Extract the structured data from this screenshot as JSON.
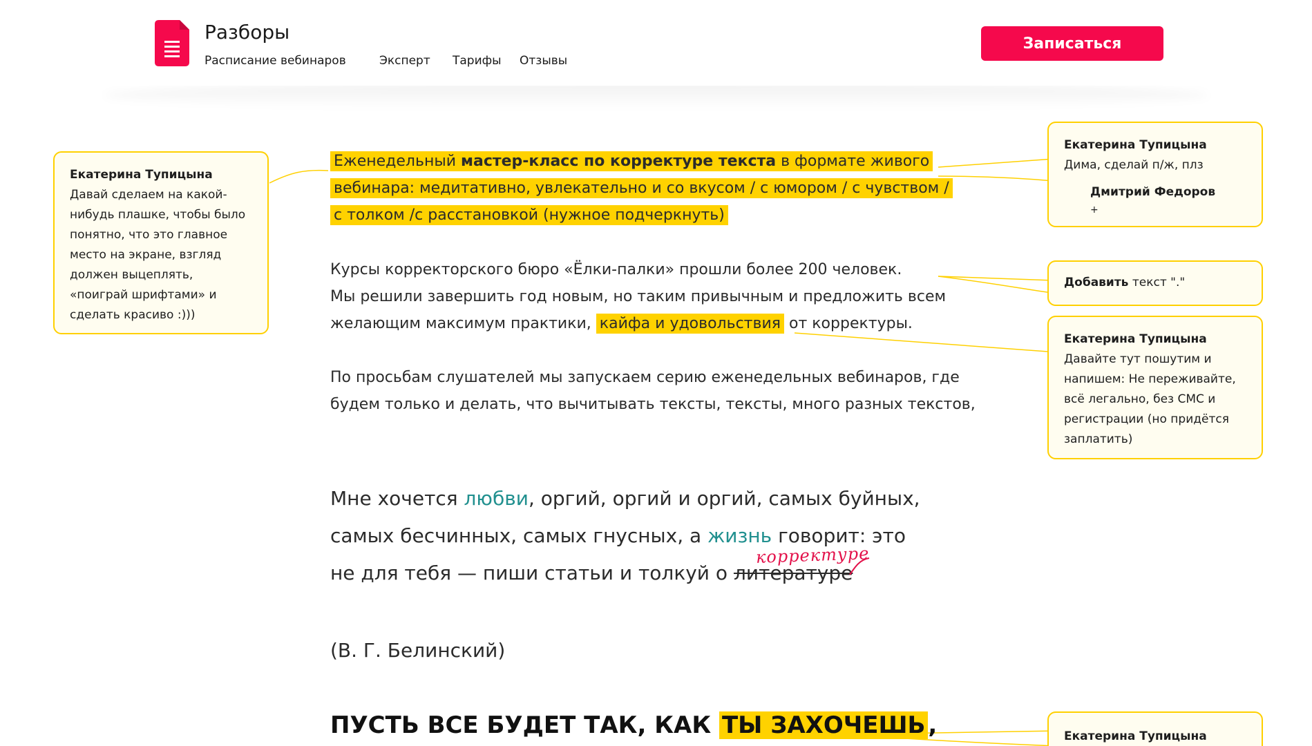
{
  "header": {
    "brand": "Разборы",
    "nav": [
      "Расписание вебинаров",
      "Эксперт",
      "Тарифы",
      "Отзывы"
    ],
    "cta_label": "Записаться"
  },
  "content": {
    "intro": {
      "p1": "Еженедельный ",
      "p1_bold": "мастер-класс по корректуре текста",
      "p1_end": " в формате живого",
      "line2": "вебинара: медитативно, увлекательно и со вкусом / с юмором / с чувством /",
      "line3": "с толком /с расстановкой (нужное подчеркнуть)"
    },
    "about": {
      "line1": "Курсы корректорского бюро «Ёлки-палки» прошли более 200 человек.",
      "line2": "Мы решили завершить год новым, но таким привычным и предложить всем",
      "line3_a": "желающим максимум практики, ",
      "line3_hl": "кайфа и удовольствия",
      "line3_b": " от корректуры."
    },
    "webinars": {
      "line1": "По просьбам слушателей мы запускаем серию еженедельных вебинаров, где",
      "line2": "будем только и делать, что вычитывать тексты, тексты, много разных текстов,"
    },
    "quote": {
      "l1_a": "Мне хочется ",
      "l1_green": "любви",
      "l1_b": ", оргий, оргий и оргий, самых буйных,",
      "l2_a": "самых бесчинных, самых гнусных, а ",
      "l2_green": "жизнь",
      "l2_b": " говорит: это",
      "l3_a": "не для тебя — пиши статьи и толкуй о ",
      "l3_strike": "литературе",
      "correction": "корректуре"
    },
    "author": "(В. Г. Белинский)",
    "slogan_a": "ПУСТЬ ВСЕ БУДЕТ ТАК, КАК ",
    "slogan_hl": "ТЫ ЗАХОЧЕШЬ",
    "slogan_b": ","
  },
  "comments": {
    "left": {
      "author": "Екатерина Тупицына",
      "lines": [
        "Давай сделаем на какой-",
        "нибудь плашке, чтобы было",
        "понятно, что это главное",
        "место на экране, взгляд",
        "должен выцеплять,",
        "«поиграй шрифтами» и",
        "сделать красиво :)))"
      ]
    },
    "c1": {
      "author": "Екатерина Тупицына",
      "text": "Дима, сделай п/ж, плз",
      "reply_author": "Дмитрий Федоров",
      "reply_text": "+"
    },
    "c2": {
      "bold": "Добавить",
      "text": " текст \".\""
    },
    "c3": {
      "author": "Екатерина Тупицына",
      "lines": [
        "Давайте тут пошутим и",
        "напишем: Не переживайте,",
        "всё легально, без СМС и",
        "регистрации (но придётся",
        "заплатить)"
      ]
    },
    "c4": {
      "author": "Екатерина Тупицына"
    }
  },
  "colors": {
    "accent": "#f5094c",
    "highlight": "#ffd200",
    "comment_border": "#ffd000",
    "green": "#21908f"
  },
  "icons": {
    "logo": "document-icon"
  }
}
